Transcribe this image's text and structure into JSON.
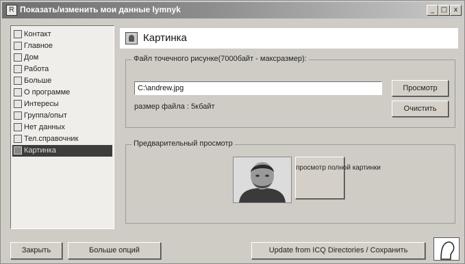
{
  "window": {
    "title": "Показать/изменить мои данные lymnyk",
    "min_label": "_",
    "max_label": "□",
    "close_label": "x"
  },
  "sidebar": {
    "items": [
      {
        "label": "Контакт",
        "icon": "contact-card-icon"
      },
      {
        "label": "Главное",
        "icon": "main-diamond-icon"
      },
      {
        "label": "Дом",
        "icon": "home-icon"
      },
      {
        "label": "Работа",
        "icon": "work-icon"
      },
      {
        "label": "Больше",
        "icon": "more-page-icon"
      },
      {
        "label": "О программе",
        "icon": "about-page-icon"
      },
      {
        "label": "Интересы",
        "icon": "interests-icon"
      },
      {
        "label": "Группа/опыт",
        "icon": "group-tree-icon"
      },
      {
        "label": "Нет данных",
        "icon": "no-data-icon"
      },
      {
        "label": "Тел.справочник",
        "icon": "phonebook-icon"
      },
      {
        "label": "Картинка",
        "icon": "picture-icon"
      }
    ],
    "active_index": 10
  },
  "header": {
    "title": "Картинка"
  },
  "file_group": {
    "label": "Файл точечного рисунке(7000байт - максразмер):",
    "file_value": "C:\\andrew.jpg",
    "size_text": "размер файла : 5кбайт",
    "view_button": "Просмотр",
    "clear_button": "Очистить"
  },
  "preview_group": {
    "label": "Предварительный просмотр",
    "full_view_button": "просмотр полной картинки"
  },
  "footer": {
    "close_button": "Закрыть",
    "more_options_button": "Больше опций",
    "update_save_button": "Update from ICQ Directories / Сохранить"
  },
  "colors": {
    "active_item_bg": "#3d3d3d",
    "title_bar": "#6f6f6f"
  }
}
